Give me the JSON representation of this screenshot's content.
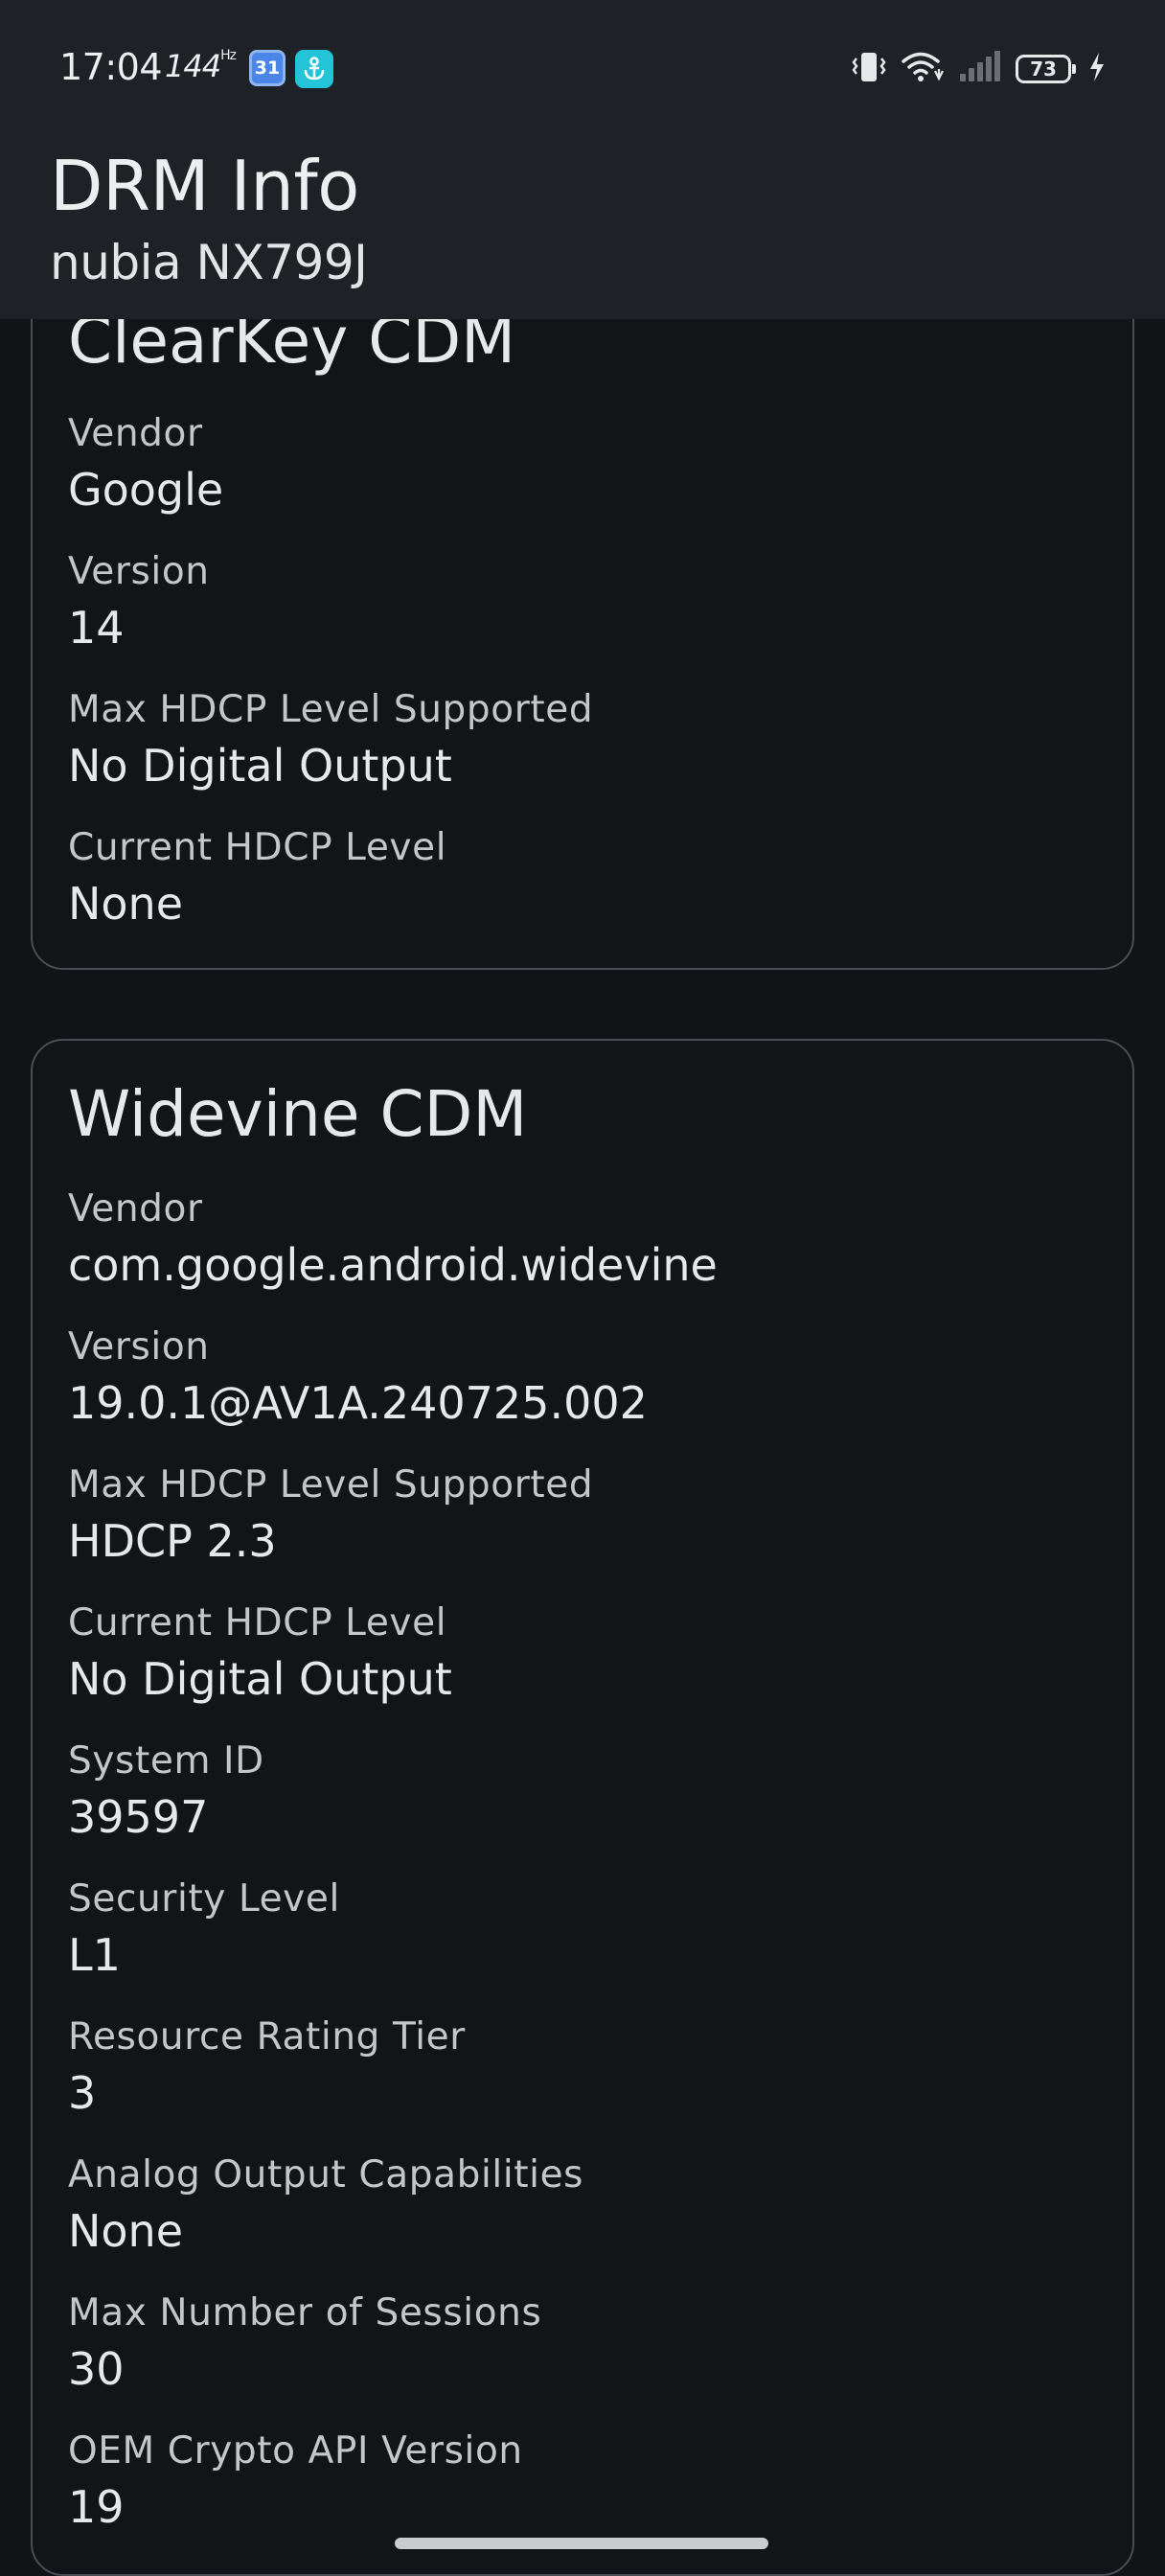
{
  "status_bar": {
    "time": "17:04",
    "refresh_rate": "144",
    "refresh_unit": "Hz",
    "calendar_day": "31",
    "battery_level": "73",
    "icons": [
      "calendar-icon",
      "app-notification-icon",
      "vibrate-icon",
      "wifi-icon",
      "signal-icon",
      "battery-icon",
      "charging-icon"
    ]
  },
  "app_bar": {
    "title": "DRM Info",
    "subtitle": "nubia NX799J"
  },
  "cards": [
    {
      "title": "ClearKey CDM",
      "fields": [
        {
          "label": "Vendor",
          "value": "Google"
        },
        {
          "label": "Version",
          "value": "14"
        },
        {
          "label": "Max HDCP Level Supported",
          "value": "No Digital Output"
        },
        {
          "label": "Current HDCP Level",
          "value": "None"
        }
      ]
    },
    {
      "title": "Widevine CDM",
      "fields": [
        {
          "label": "Vendor",
          "value": "com.google.android.widevine"
        },
        {
          "label": "Version",
          "value": "19.0.1@AV1A.240725.002"
        },
        {
          "label": "Max HDCP Level Supported",
          "value": "HDCP 2.3"
        },
        {
          "label": "Current HDCP Level",
          "value": "No Digital Output"
        },
        {
          "label": "System ID",
          "value": "39597"
        },
        {
          "label": "Security Level",
          "value": "L1"
        },
        {
          "label": "Resource Rating Tier",
          "value": "3"
        },
        {
          "label": "Analog Output Capabilities",
          "value": "None"
        },
        {
          "label": "Max Number of Sessions",
          "value": "30"
        },
        {
          "label": "OEM Crypto API Version",
          "value": "19"
        }
      ]
    }
  ],
  "colors": {
    "background": "#111417",
    "app_bar": "#1e2126",
    "card_border": "#4a4e53",
    "label_text": "#c4c7ca",
    "value_text": "#e6e8ea"
  }
}
